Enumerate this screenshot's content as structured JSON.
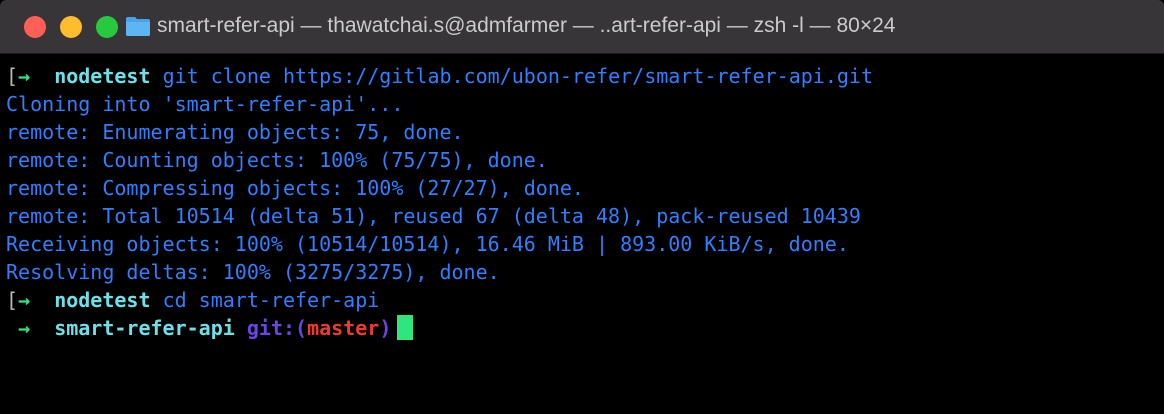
{
  "window": {
    "title": "smart-refer-api — thawatchai.s@admfarmer — ..art-refer-api — zsh -l — 80×24",
    "buttons": {
      "close_icon": "close-dot",
      "minimize_icon": "minimize-dot",
      "zoom_icon": "zoom-dot"
    },
    "folder_icon": "folder-icon"
  },
  "colors": {
    "background": "#000000",
    "titlebar": "#373538",
    "output_blue": "#2f7fff",
    "prompt_arrow_green": "#2ee67b",
    "dir_cyan": "#6fe0e8",
    "git_purple": "#6c45e6",
    "branch_red": "#ee3a30",
    "cursor_green": "#2ee67b"
  },
  "terminal": {
    "prompt1": {
      "arrow": "→",
      "dir": "nodetest",
      "command": "git clone https://gitlab.com/ubon-refer/smart-refer-api.git"
    },
    "output": [
      "Cloning into 'smart-refer-api'...",
      "remote: Enumerating objects: 75, done.",
      "remote: Counting objects: 100% (75/75), done.",
      "remote: Compressing objects: 100% (27/27), done.",
      "remote: Total 10514 (delta 51), reused 67 (delta 48), pack-reused 10439",
      "Receiving objects: 100% (10514/10514), 16.46 MiB | 893.00 KiB/s, done.",
      "Resolving deltas: 100% (3275/3275), done."
    ],
    "prompt2": {
      "arrow": "→",
      "dir": "nodetest",
      "command": "cd smart-refer-api"
    },
    "prompt3": {
      "arrow": "→",
      "dir": "smart-refer-api",
      "git_label": "git:",
      "branch_open": "(",
      "branch": "master",
      "branch_close": ")"
    },
    "prompt_marker": "["
  }
}
